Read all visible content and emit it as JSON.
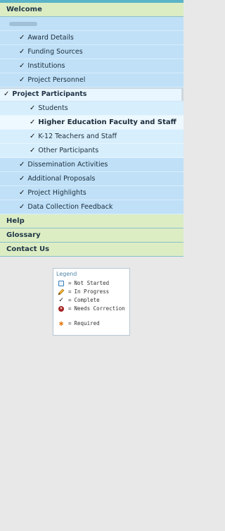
{
  "nav": {
    "welcome": "Welcome",
    "items": [
      {
        "label": "Award Details"
      },
      {
        "label": "Funding Sources"
      },
      {
        "label": "Institutions"
      },
      {
        "label": "Project Personnel"
      },
      {
        "label": "Project Participants"
      },
      {
        "label": "Dissemination Activities"
      },
      {
        "label": "Additional Proposals"
      },
      {
        "label": "Project Highlights"
      },
      {
        "label": "Data Collection Feedback"
      }
    ],
    "sub_items": [
      {
        "label": "Students"
      },
      {
        "label": "Higher Education Faculty and Staff"
      },
      {
        "label": "K-12 Teachers and Staff"
      },
      {
        "label": "Other Participants"
      }
    ],
    "help": "Help",
    "glossary": "Glossary",
    "contact": "Contact Us",
    "check_glyph": "✓"
  },
  "legend": {
    "title": "Legend",
    "equals": "=",
    "entries": [
      {
        "icon": "not-started-icon",
        "label": "Not Started"
      },
      {
        "icon": "pencil-icon",
        "label": "In Progress"
      },
      {
        "icon": "check-icon",
        "label": "Complete"
      },
      {
        "icon": "error-icon",
        "label": "Needs Correction"
      },
      {
        "icon": "asterisk-icon",
        "label": "Required"
      }
    ]
  }
}
